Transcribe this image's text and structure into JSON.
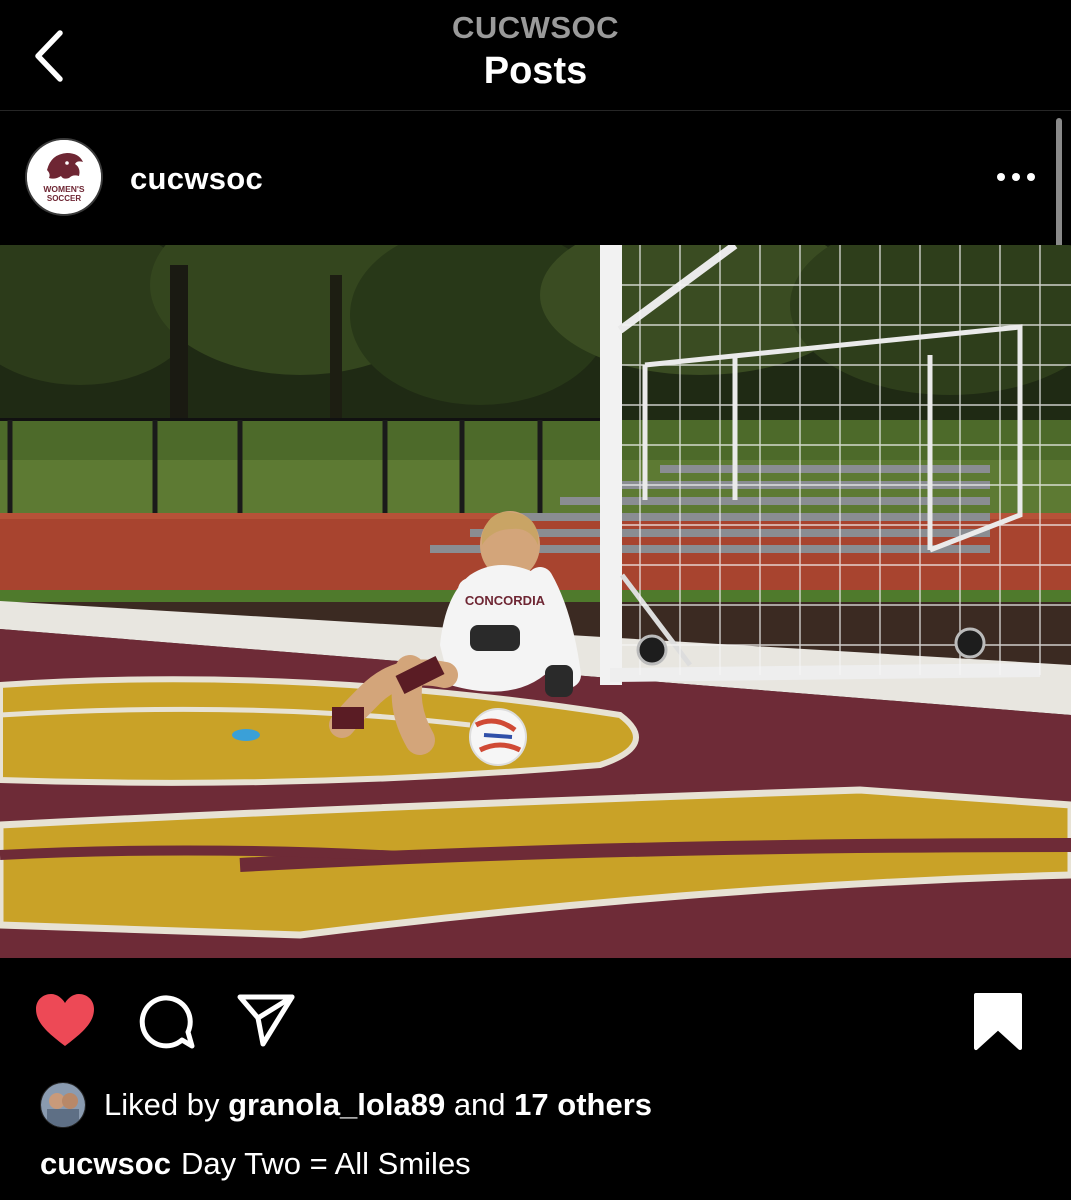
{
  "header": {
    "account_handle": "CUCWSOC",
    "title": "Posts",
    "back_icon": "chevron-left-icon"
  },
  "post": {
    "username": "cucwsoc",
    "avatar_text_line1": "WOMEN'S",
    "avatar_text_line2": "SOCCER",
    "more_icon": "more-horizontal-icon",
    "photo_alt": "Soccer goalkeeper in white practice jersey diving on the ball in front of a goal on a maroon and gold field",
    "jersey_text": "CONCORDIA",
    "liked": true,
    "like_color": "#ed4956",
    "liked_by_prefix": "Liked by",
    "liked_by_user": "granola_lola89",
    "liked_by_and": "and",
    "liked_by_others": "17 others",
    "caption_user": "cucwsoc",
    "caption_text": "Day Two = All Smiles"
  },
  "actions": {
    "like_icon": "heart-filled-icon",
    "comment_icon": "comment-icon",
    "share_icon": "send-icon",
    "save_icon": "bookmark-filled-icon"
  },
  "colors": {
    "background": "#000000",
    "field_maroon": "#6e2b37",
    "field_gold": "#c9a227",
    "track_red": "#a8442f"
  }
}
